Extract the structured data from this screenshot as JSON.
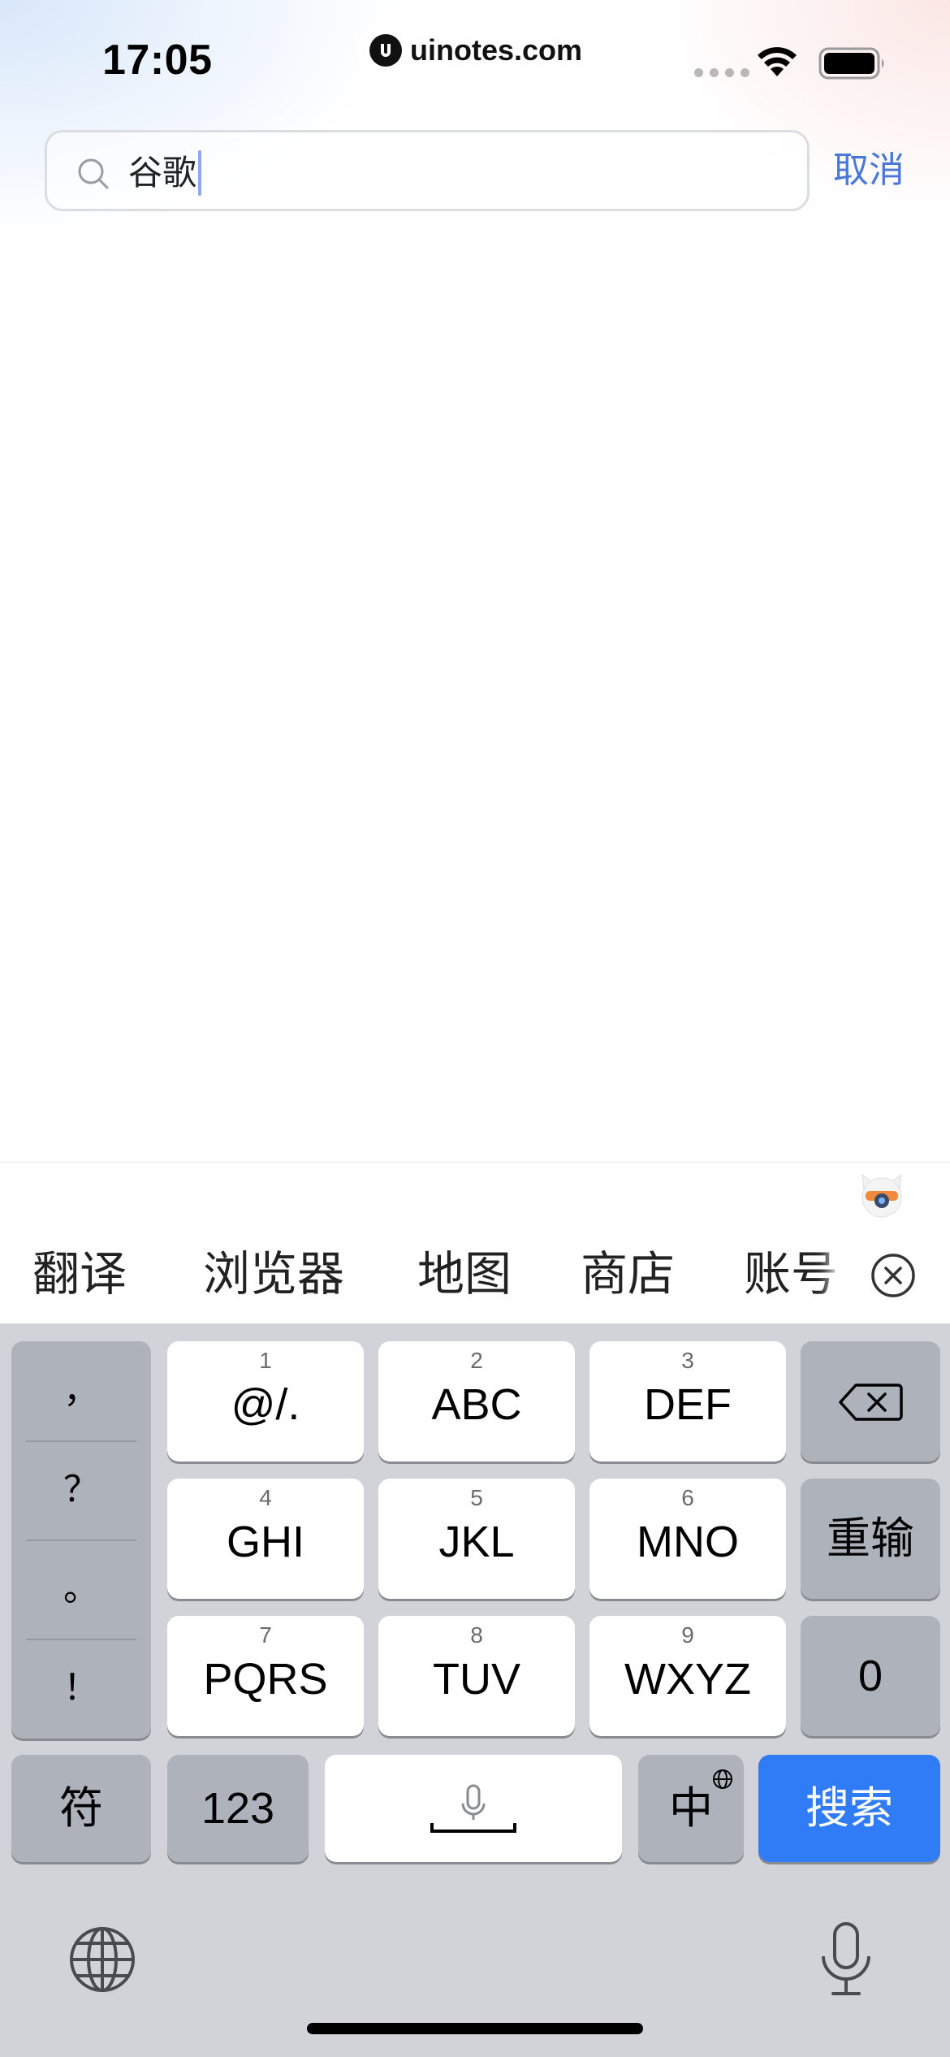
{
  "status_bar": {
    "time": "17:05",
    "watermark": "uinotes.com"
  },
  "search": {
    "query": "谷歌",
    "cancel_label": "取消"
  },
  "candidates": [
    "翻译",
    "浏览器",
    "地图",
    "商店",
    "账号"
  ],
  "keyboard": {
    "punctuation": [
      "，",
      "？",
      "。",
      "！"
    ],
    "keys": [
      {
        "num": "1",
        "letters": "@/."
      },
      {
        "num": "2",
        "letters": "ABC"
      },
      {
        "num": "3",
        "letters": "DEF"
      },
      {
        "num": "4",
        "letters": "GHI"
      },
      {
        "num": "5",
        "letters": "JKL"
      },
      {
        "num": "6",
        "letters": "MNO"
      },
      {
        "num": "7",
        "letters": "PQRS"
      },
      {
        "num": "8",
        "letters": "TUV"
      },
      {
        "num": "9",
        "letters": "WXYZ"
      }
    ],
    "reenter_label": "重输",
    "zero_label": "0",
    "symbols_label": "符",
    "numbers_label": "123",
    "language_label": "中",
    "search_label": "搜索"
  },
  "colors": {
    "accent": "#2f7cf6",
    "cancel_text": "#4a78d6",
    "keyboard_bg": "#d2d3d9"
  },
  "icons": [
    "search-icon",
    "wifi-icon",
    "battery-icon",
    "mascot-icon",
    "close-circle-icon",
    "backspace-icon",
    "mic-icon",
    "globe-icon"
  ]
}
